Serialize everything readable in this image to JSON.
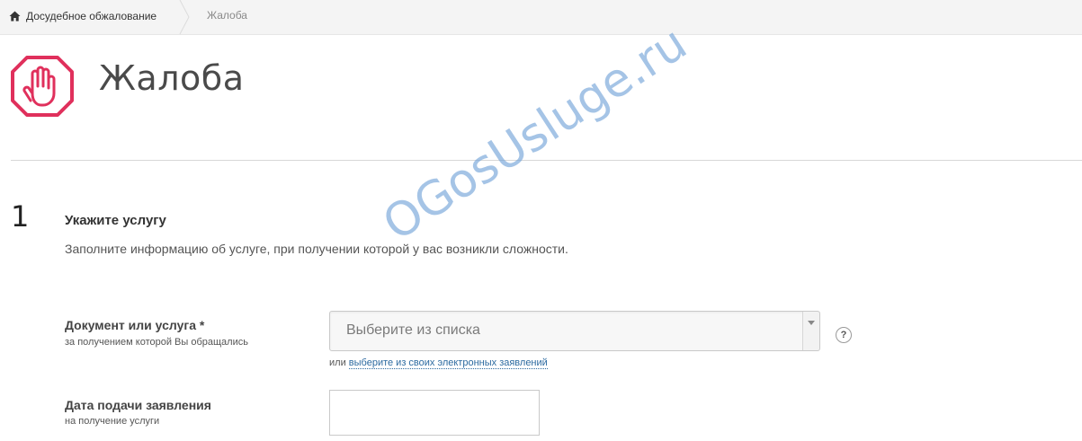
{
  "breadcrumb": {
    "home_label": "Досудебное обжалование",
    "current_label": "Жалоба"
  },
  "header": {
    "icon": "raised-hand-icon",
    "title": "Жалоба",
    "accent_color": "#e0305c"
  },
  "step": {
    "number": "1",
    "title": "Укажите услугу",
    "description": "Заполните информацию об услуге, при получении которой у вас возникли сложности."
  },
  "fields": {
    "service": {
      "label": "Документ или услуга *",
      "hint": "за получением которой Вы обращались",
      "placeholder": "Выберите из списка",
      "help_label": "?",
      "alt_prefix": "или",
      "alt_link": "выберите из своих электронных заявлений"
    },
    "date": {
      "label": "Дата подачи заявления",
      "hint": "на получение услуги",
      "value": ""
    }
  },
  "watermark": "OGosUsluge.ru"
}
